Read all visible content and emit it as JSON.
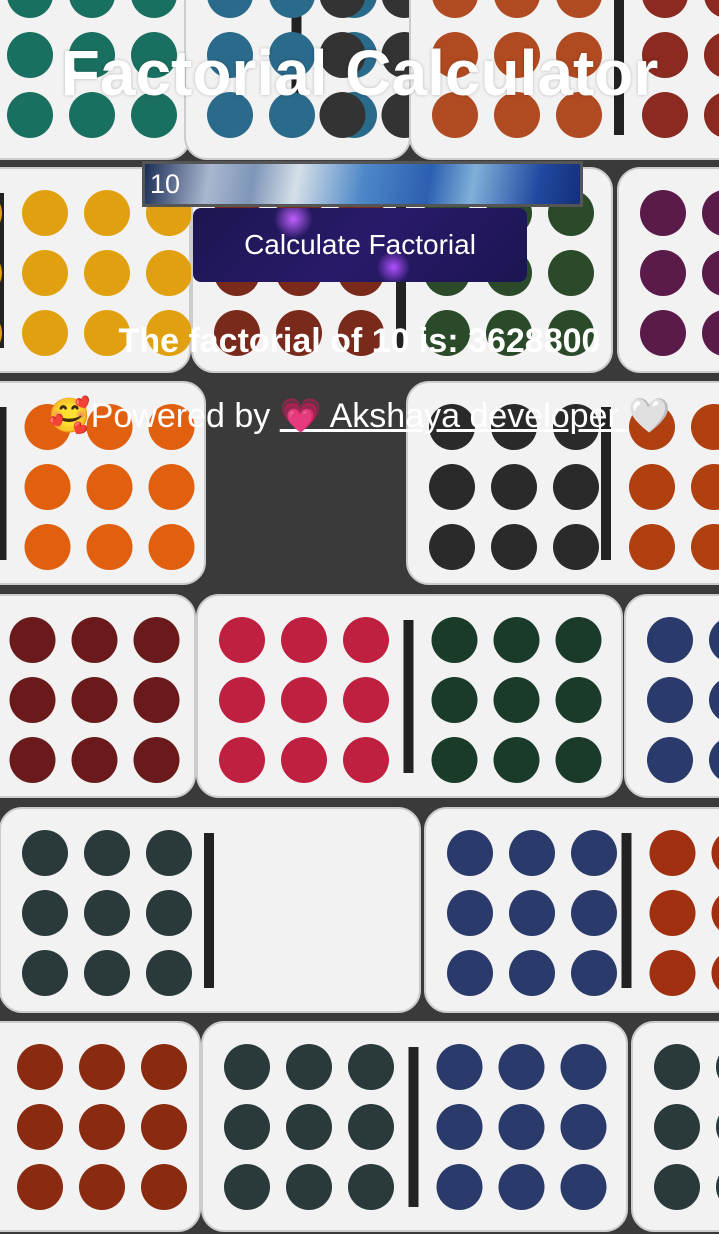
{
  "title": "Factorial Calculator",
  "input": {
    "value": "10"
  },
  "button": {
    "label": "Calculate Factorial"
  },
  "result": "The factorial of 10 is: 3628800",
  "footer": {
    "prefix_emoji": "🥰",
    "text": "Powered by ",
    "link_emoji": "💗",
    "link_text": " Akshaya developer ",
    "suffix_emoji": "🤍"
  },
  "colors": {
    "text": "#ffffff",
    "button_bg": "#1f1858",
    "input_border": "#555555"
  }
}
